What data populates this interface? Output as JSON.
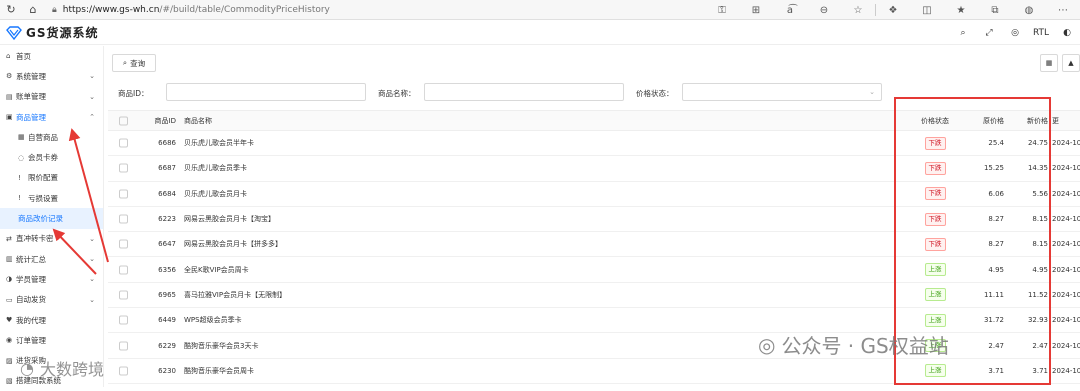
{
  "browser": {
    "url_host": "https://www.gs-wh.cn",
    "url_path": "/#/build/table/CommodityPriceHistory"
  },
  "app": {
    "logo_text": "GS货源系统",
    "tools": [
      "search-icon",
      "fullscreen-icon",
      "globe-icon",
      "RTL",
      "avatar"
    ],
    "rtl_label": "RTL"
  },
  "sidebar": {
    "items": [
      {
        "label": "首页",
        "icon": "home-icon"
      },
      {
        "label": "系统管理",
        "icon": "gear-icon",
        "expandable": true
      },
      {
        "label": "账单管理",
        "icon": "bill-icon",
        "expandable": true
      },
      {
        "label": "商品管理",
        "icon": "goods-icon",
        "expandable": true,
        "active": true
      },
      {
        "label": "自营商品",
        "icon": "calendar-icon",
        "sub": true
      },
      {
        "label": "会员卡券",
        "icon": "coupon-icon",
        "sub": true
      },
      {
        "label": "限价配置",
        "icon": "exclaim-icon",
        "sub": true
      },
      {
        "label": "亏损设置",
        "icon": "exclaim-icon",
        "sub": true
      },
      {
        "label": "商品改价记录",
        "icon": "",
        "sub": true,
        "selected": true
      },
      {
        "label": "直冲转卡密",
        "icon": "swap-icon",
        "expandable": true
      },
      {
        "label": "统计汇总",
        "icon": "stats-icon",
        "expandable": true
      },
      {
        "label": "学员管理",
        "icon": "user-icon",
        "expandable": true
      },
      {
        "label": "自动发货",
        "icon": "car-icon",
        "expandable": true
      },
      {
        "label": "我的代理",
        "icon": "agent-icon"
      },
      {
        "label": "订单管理",
        "icon": "order-icon"
      },
      {
        "label": "进货采购",
        "icon": "cart-icon"
      },
      {
        "label": "搭建同款系统",
        "icon": "build-icon"
      }
    ]
  },
  "toolbar": {
    "query_label": "查询"
  },
  "filters": {
    "product_id_label": "商品ID：",
    "product_name_label": "商品名称：",
    "price_status_label": "价格状态："
  },
  "table": {
    "headers": {
      "id": "商品ID",
      "name": "商品名称",
      "status": "价格状态",
      "orig": "原价格",
      "new": "新价格",
      "date": "更"
    },
    "rows": [
      {
        "id": "6686",
        "name": "贝乐虎儿歌会员半年卡",
        "status": "下跌",
        "dir": "down",
        "orig": "25.4",
        "new": "24.75",
        "date": "2024-10"
      },
      {
        "id": "6687",
        "name": "贝乐虎儿歌会员季卡",
        "status": "下跌",
        "dir": "down",
        "orig": "15.25",
        "new": "14.35",
        "date": "2024-10"
      },
      {
        "id": "6684",
        "name": "贝乐虎儿歌会员月卡",
        "status": "下跌",
        "dir": "down",
        "orig": "6.06",
        "new": "5.56",
        "date": "2024-10"
      },
      {
        "id": "6223",
        "name": "网易云黑胶会员月卡【淘宝】",
        "status": "下跌",
        "dir": "down",
        "orig": "8.27",
        "new": "8.15",
        "date": "2024-10"
      },
      {
        "id": "6647",
        "name": "网易云黑胶会员月卡【拼多多】",
        "status": "下跌",
        "dir": "down",
        "orig": "8.27",
        "new": "8.15",
        "date": "2024-10"
      },
      {
        "id": "6356",
        "name": "全民K歌VIP会员周卡",
        "status": "上涨",
        "dir": "up",
        "orig": "4.95",
        "new": "4.95",
        "date": "2024-10"
      },
      {
        "id": "6965",
        "name": "喜马拉雅VIP会员月卡【无限制】",
        "status": "上涨",
        "dir": "up",
        "orig": "11.11",
        "new": "11.52",
        "date": "2024-10"
      },
      {
        "id": "6449",
        "name": "WPS超级会员季卡",
        "status": "上涨",
        "dir": "up",
        "orig": "31.72",
        "new": "32.93",
        "date": "2024-10"
      },
      {
        "id": "6229",
        "name": "酷狗音乐豪华会员3天卡",
        "status": "上涨",
        "dir": "up",
        "orig": "2.47",
        "new": "2.47",
        "date": "2024-10"
      },
      {
        "id": "6230",
        "name": "酷狗音乐豪华会员周卡",
        "status": "上涨",
        "dir": "up",
        "orig": "3.71",
        "new": "3.71",
        "date": "2024-10"
      }
    ]
  },
  "watermark": {
    "right": "公众号 · GS权益站",
    "left": "大数跨境"
  },
  "colors": {
    "accent": "#1677ff",
    "annotation": "#e53935",
    "down": "#cf1322",
    "up": "#389e0d"
  }
}
